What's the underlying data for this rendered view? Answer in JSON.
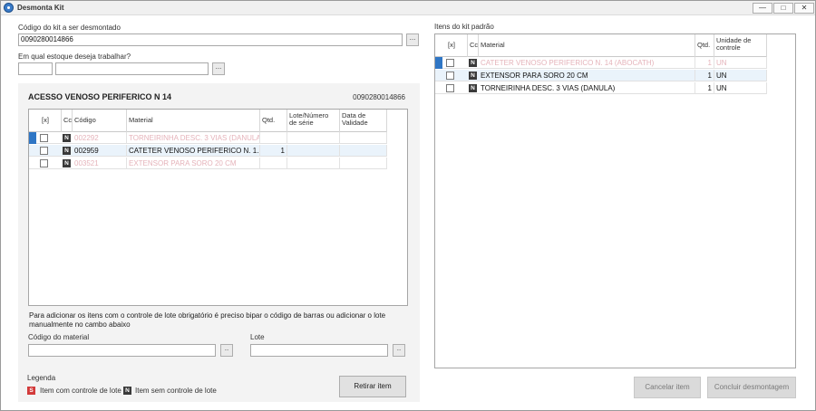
{
  "window": {
    "title": "Desmonta Kit",
    "minimize_glyph": "—",
    "maximize_glyph": "□",
    "close_glyph": "✕"
  },
  "kit_code": {
    "label": "Código do kit a ser desmontado",
    "value": "0090280014866",
    "lookup_glyph": "..."
  },
  "stock": {
    "label": "Em qual estoque deseja trabalhar?",
    "code_value": "",
    "name_value": "",
    "lookup_glyph": "..."
  },
  "kit_panel": {
    "title": "ACESSO VENOSO PERIFERICO N 14",
    "code": "0090280014866",
    "grid": {
      "headers": {
        "check": "[x]",
        "cc": "Cc",
        "code": "Código",
        "material": "Material",
        "qty": "Qtd.",
        "lot": "Lote/Número de série",
        "validity": "Data de Validade"
      },
      "rows": [
        {
          "badge": "N",
          "code": "002292",
          "material": "TORNEIRINHA DESC. 3 VIAS (DANULA)",
          "qty": "",
          "lot": "",
          "validity": "",
          "faded": true,
          "selected": false,
          "active": true
        },
        {
          "badge": "N",
          "code": "002959",
          "material": "CATETER VENOSO PERIFERICO N. 1...",
          "qty": "1",
          "lot": "",
          "validity": "",
          "faded": false,
          "selected": true,
          "active": false
        },
        {
          "badge": "N",
          "code": "003521",
          "material": "EXTENSOR PARA SORO 20 CM",
          "qty": "",
          "lot": "",
          "validity": "",
          "faded": true,
          "selected": false,
          "active": false
        }
      ]
    },
    "note": "Para adicionar os itens com o controle de lote obrigatório é preciso bipar o código de barras ou adicionar o lote manualmente no cambo abaixo",
    "material_code_label": "Código do material",
    "material_code_value": "",
    "lot_label": "Lote",
    "lot_value": "",
    "lookup_glyph": "..",
    "legend": {
      "title": "Legenda",
      "s_badge": "S",
      "s_text": "Item com controle de lote",
      "n_badge": "N",
      "n_text": "Item sem controle de lote"
    },
    "remove_button": "Retirar item"
  },
  "standard_items": {
    "label": "Itens do kit padrão",
    "grid": {
      "headers": {
        "check": "[x]",
        "cc": "Cc",
        "material": "Material",
        "qty": "Qtd.",
        "unit": "Unidade de controle"
      },
      "rows": [
        {
          "badge": "N",
          "material": "CATETER VENOSO PERIFERICO N. 14 (ABOCATH)",
          "qty": "1",
          "unit": "UN",
          "faded": true,
          "selected": false,
          "active": true
        },
        {
          "badge": "N",
          "material": "EXTENSOR PARA SORO 20 CM",
          "qty": "1",
          "unit": "UN",
          "faded": false,
          "selected": true,
          "active": false
        },
        {
          "badge": "N",
          "material": "TORNEIRINHA DESC. 3 VIAS (DANULA)",
          "qty": "1",
          "unit": "UN",
          "faded": false,
          "selected": false,
          "active": false
        }
      ]
    }
  },
  "actions": {
    "cancel_item": "Cancelar item",
    "finish": "Concluir desmontagem"
  },
  "colors": {
    "selection": "#2f76c5",
    "faded_text": "#e5b3ba",
    "badge_n": "#3a3a3a",
    "badge_s": "#d23a3a"
  }
}
